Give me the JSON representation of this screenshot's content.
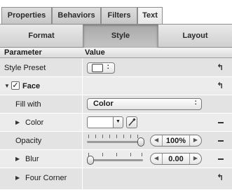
{
  "tabs": [
    {
      "label": "Properties",
      "active": false
    },
    {
      "label": "Behaviors",
      "active": false
    },
    {
      "label": "Filters",
      "active": false
    },
    {
      "label": "Text",
      "active": true
    }
  ],
  "subtabs": [
    {
      "label": "Format",
      "active": false
    },
    {
      "label": "Style",
      "active": true
    },
    {
      "label": "Layout",
      "active": false
    }
  ],
  "columns": {
    "parameter": "Parameter",
    "value": "Value"
  },
  "rows": {
    "style_preset": {
      "label": "Style Preset",
      "popup_arrow": ":"
    },
    "face": {
      "label": "Face",
      "checked": true,
      "check": "✓"
    },
    "fill_with": {
      "label": "Fill with",
      "value": "Color"
    },
    "color": {
      "label": "Color",
      "swatch_color": "#ffffff"
    },
    "opacity": {
      "label": "Opacity",
      "value": "100%",
      "level": 1.0
    },
    "blur": {
      "label": "Blur",
      "value": "0.00",
      "level": 0.0
    },
    "four_corner": {
      "label": "Four Corner"
    }
  },
  "icons": {
    "reset": "↰",
    "disclosure_open": "▼",
    "disclosure_closed": "▶",
    "step_left": "◀",
    "step_right": "▶",
    "popup_arrows": "⇕"
  },
  "colors": {
    "active_tab": "#f0f0f0",
    "panel": "#e8e8e8"
  }
}
